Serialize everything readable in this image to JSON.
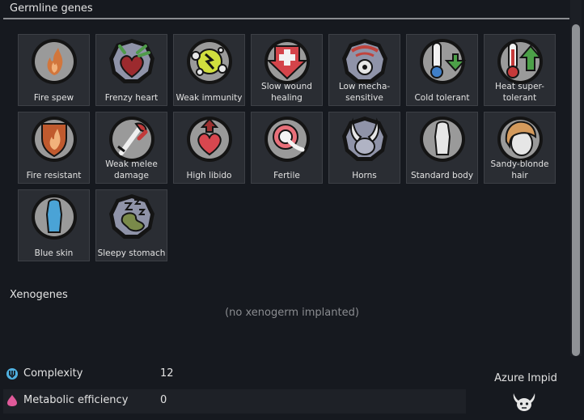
{
  "germline": {
    "title": "Germline genes",
    "genes": [
      {
        "label": "Fire spew",
        "icon": "fire-spew-icon"
      },
      {
        "label": "Frenzy heart",
        "icon": "frenzy-heart-icon"
      },
      {
        "label": "Weak immunity",
        "icon": "weak-immunity-icon"
      },
      {
        "label": "Slow wound healing",
        "icon": "slow-wound-healing-icon"
      },
      {
        "label": "Low mecha-sensitive",
        "icon": "low-mechasensitive-icon"
      },
      {
        "label": "Cold tolerant",
        "icon": "cold-tolerant-icon"
      },
      {
        "label": "Heat super-tolerant",
        "icon": "heat-super-tolerant-icon"
      },
      {
        "label": "Fire resistant",
        "icon": "fire-resistant-icon"
      },
      {
        "label": "Weak melee damage",
        "icon": "weak-melee-damage-icon"
      },
      {
        "label": "High libido",
        "icon": "high-libido-icon"
      },
      {
        "label": "Fertile",
        "icon": "fertile-icon"
      },
      {
        "label": "Horns",
        "icon": "horns-icon"
      },
      {
        "label": "Standard body",
        "icon": "standard-body-icon"
      },
      {
        "label": "Sandy-blonde hair",
        "icon": "sandy-blonde-hair-icon"
      },
      {
        "label": "Blue skin",
        "icon": "blue-skin-icon"
      },
      {
        "label": "Sleepy stomach",
        "icon": "sleepy-stomach-icon"
      }
    ]
  },
  "xenogenes": {
    "title": "Xenogenes",
    "empty_text": "(no xenogerm implanted)"
  },
  "stats": {
    "complexity": {
      "label": "Complexity",
      "value": "12",
      "icon": "complexity-icon"
    },
    "metabolic": {
      "label": "Metabolic efficiency",
      "value": "0",
      "icon": "metabolic-efficiency-icon"
    }
  },
  "species": {
    "name": "Azure Impid",
    "icon": "impid-head-icon"
  },
  "colors": {
    "tile_bg": "#2a2d33",
    "panel_bg": "#16191f",
    "muted_text": "#8a8c90",
    "complexity_blue": "#4fb0e0",
    "metabolic_pink": "#e05a9a"
  }
}
